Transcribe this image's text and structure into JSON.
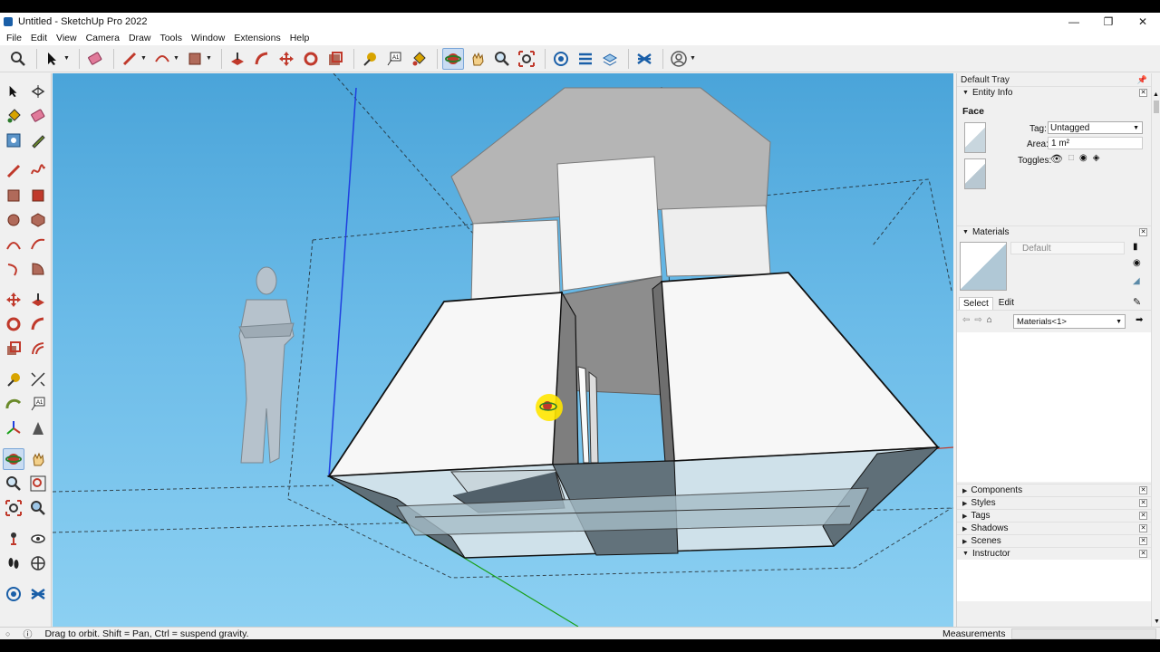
{
  "window": {
    "title": "Untitled - SketchUp Pro 2022",
    "controls": [
      "minimize-icon",
      "restore-icon",
      "close-icon"
    ]
  },
  "menu": [
    "File",
    "Edit",
    "View",
    "Camera",
    "Draw",
    "Tools",
    "Window",
    "Extensions",
    "Help"
  ],
  "toolbar": {
    "tools": [
      "search-icon",
      "select-icon",
      "eraser-icon",
      "pencil-icon",
      "arc-icon",
      "rectangle-icon",
      "push-pull-icon",
      "follow-me-icon",
      "move-icon",
      "rotate-icon",
      "offset-icon",
      "tape-icon",
      "text-icon",
      "paint-icon",
      "orbit-icon",
      "pan-icon",
      "zoom-icon",
      "zoom-extents-icon",
      "warehouse-icon",
      "extension-icon",
      "layout-icon",
      "styles-icon",
      "account-icon"
    ],
    "active": "orbit-icon"
  },
  "tray": {
    "title": "Default Tray",
    "entity_info": {
      "header": "Entity Info",
      "entity_type": "Face",
      "tag_label": "Tag:",
      "tag_value": "Untagged",
      "area_label": "Area:",
      "area_value": "1 m²",
      "toggles_label": "Toggles:"
    },
    "materials": {
      "header": "Materials",
      "current_name": "Default",
      "tab_select": "Select",
      "tab_edit": "Edit",
      "collection": "Materials<1>"
    },
    "collapsed_panels": [
      "Components",
      "Styles",
      "Tags",
      "Shadows",
      "Scenes"
    ],
    "instructor": "Instructor"
  },
  "status": {
    "message": "Drag to orbit. Shift = Pan, Ctrl = suspend gravity.",
    "measurements_label": "Measurements",
    "measurements_value": ""
  },
  "colors": {
    "sky_top": "#4aa4d9",
    "sky_bottom": "#8cd0f2",
    "face_front": "#f8f8f8",
    "face_back": "#bcbcbc",
    "axis_blue": "#1f3fe0",
    "axis_green": "#18a018",
    "cursor_highlight": "#ffe600"
  }
}
